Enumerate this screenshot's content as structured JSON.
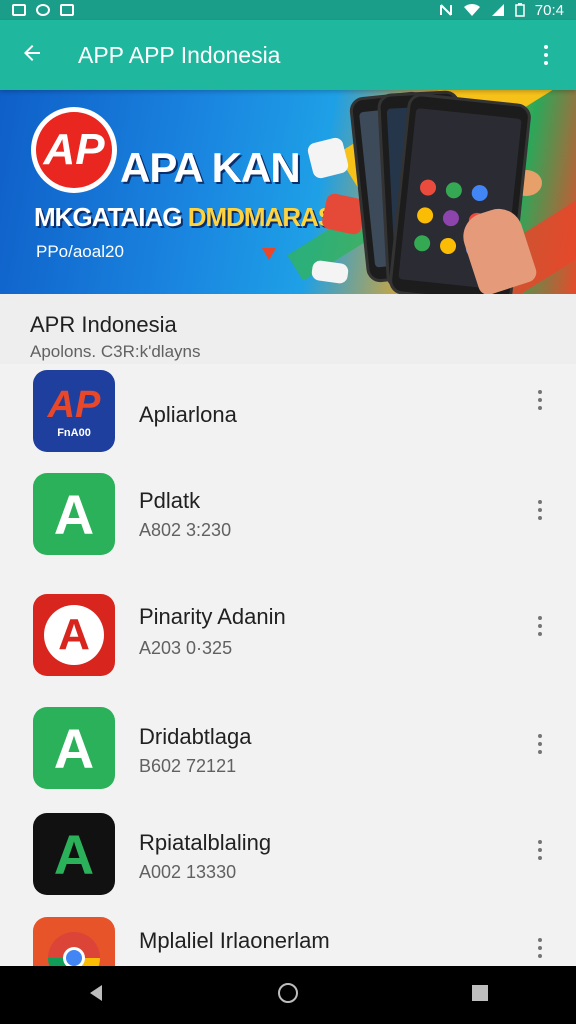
{
  "status_bar": {
    "time": "70:4"
  },
  "app_bar": {
    "title": "APP APP Indonesia"
  },
  "banner": {
    "logo_text": "AP",
    "headline": "APA KAN",
    "subhead_white": "MKGATAIAG",
    "subhead_yellow": "DMDMARAS",
    "footer": "PPo/aoal20"
  },
  "section": {
    "title": "APR Indonesia",
    "subtitle": "Apolons. C3R:k'dlayns"
  },
  "apps": [
    {
      "name": "Apliarlona",
      "subtitle": "",
      "icon": "ap-logo-icon",
      "icon_bg": "#1f3f9e",
      "icon_letter": "AP",
      "icon_caption": "FnA00"
    },
    {
      "name": "Pdlatk",
      "subtitle": "A802 3:230",
      "icon": "a-logo-icon",
      "icon_bg": "#2bb159",
      "icon_letter": "A"
    },
    {
      "name": "Pinarity Adanin",
      "subtitle": "A203 0·325",
      "icon": "a-logo-icon",
      "icon_bg": "#d8261f",
      "icon_letter": "A"
    },
    {
      "name": "Dridabtlaga",
      "subtitle": "B602 72121",
      "icon": "a-logo-icon",
      "icon_bg": "#2bb159",
      "icon_letter": "A"
    },
    {
      "name": "Rpiatalblaling",
      "subtitle": "A002 13330",
      "icon": "a-logo-icon",
      "icon_bg": "#111111",
      "icon_letter": "A"
    },
    {
      "name": "Mplaliel Irlaonerlam",
      "subtitle": "",
      "icon": "chrome-logo-icon",
      "icon_bg": "#e8542a"
    }
  ],
  "colors": {
    "status_bar": "#1a9e8a",
    "app_bar": "#1fb89f",
    "background": "#eeeeee"
  }
}
